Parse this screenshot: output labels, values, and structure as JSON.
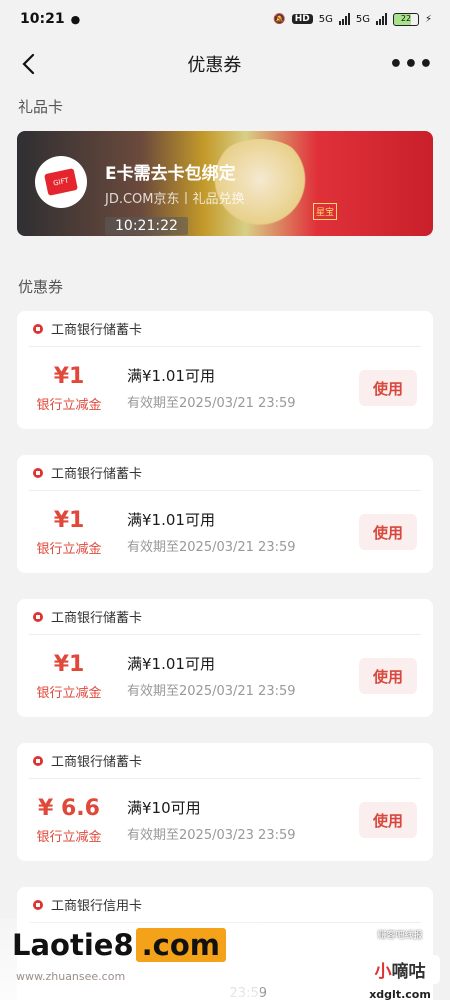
{
  "status": {
    "time": "10:21",
    "hd": "HD",
    "net1": "5G",
    "net2": "5G",
    "battery": "22"
  },
  "nav": {
    "title": "优惠券"
  },
  "gift_section": {
    "title": "礼品卡",
    "card": {
      "title": "E卡需去卡包绑定",
      "subtitle": "JD.COM京东丨礼品兑换",
      "time_overlay": "10:21:22",
      "logo_text": "GIFT",
      "stamp": "星宝"
    }
  },
  "coupon_section": {
    "title": "优惠券",
    "coupons": [
      {
        "bank": "工商银行储蓄卡",
        "amount": "¥1",
        "type": "银行立减金",
        "condition": "满¥1.01可用",
        "expire": "有效期至2025/03/21 23:59",
        "button": "使用"
      },
      {
        "bank": "工商银行储蓄卡",
        "amount": "¥1",
        "type": "银行立减金",
        "condition": "满¥1.01可用",
        "expire": "有效期至2025/03/21 23:59",
        "button": "使用"
      },
      {
        "bank": "工商银行储蓄卡",
        "amount": "¥1",
        "type": "银行立减金",
        "condition": "满¥1.01可用",
        "expire": "有效期至2025/03/21 23:59",
        "button": "使用"
      },
      {
        "bank": "工商银行储蓄卡",
        "amount": "¥ 6.6",
        "type": "银行立减金",
        "condition": "满¥10可用",
        "expire": "有效期至2025/03/23 23:59",
        "button": "使用"
      },
      {
        "bank": "工商银行信用卡",
        "expire_tail": "23:59"
      }
    ]
  },
  "watermark": {
    "main": "Laotie8",
    "com": ".com",
    "sub": "www.zhuansee.com",
    "right_top": "赚客吧线报",
    "right_logo_a": "小",
    "right_logo_b": "嘀咕",
    "right_site": "xdglt.com"
  },
  "colors": {
    "accent": "#e0493a",
    "button_bg": "#fbeeee",
    "page_bg": "#f2f2f2"
  }
}
